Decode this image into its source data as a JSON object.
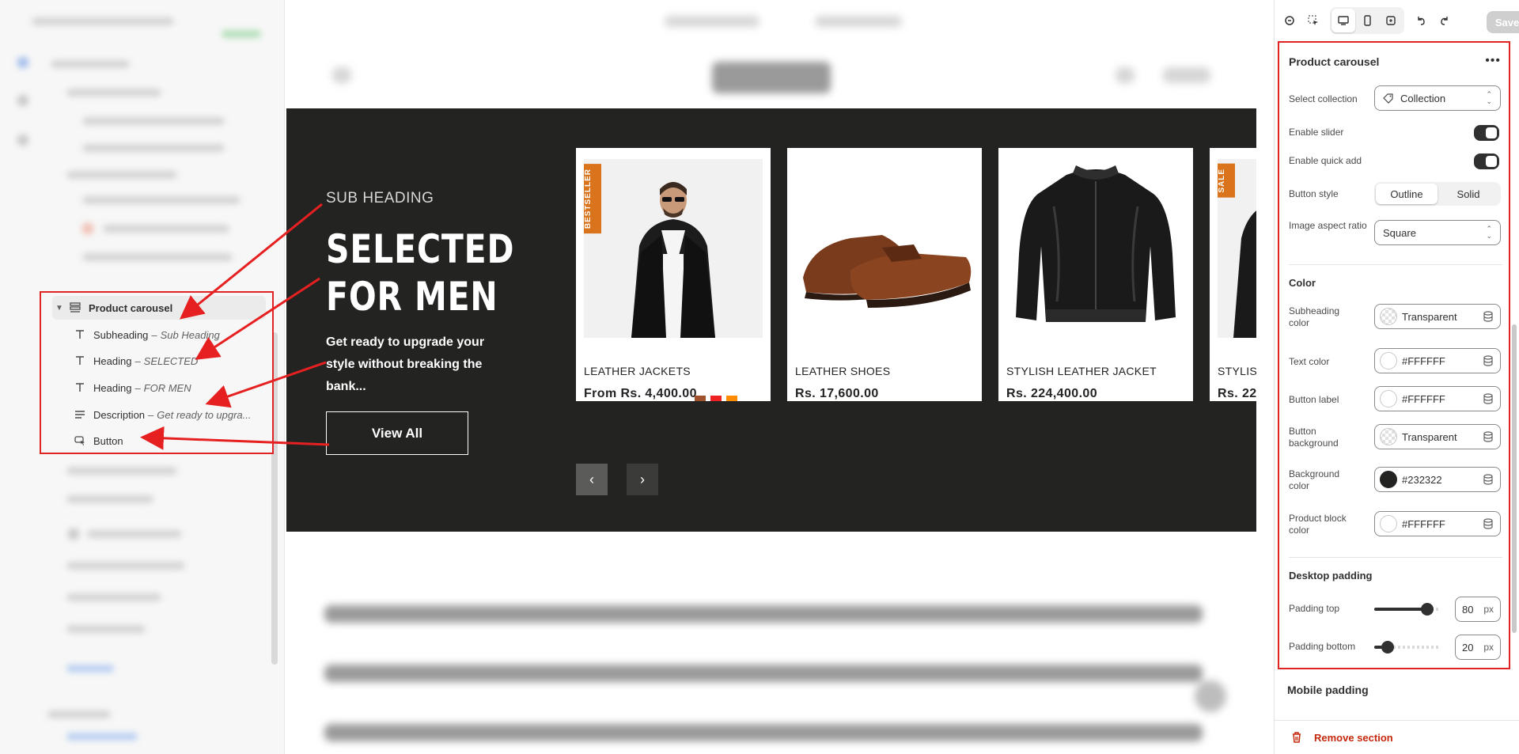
{
  "tree": {
    "parent": "Product carousel",
    "items": [
      {
        "label": "Subheading",
        "sub": "Sub Heading",
        "icon": "text-icon"
      },
      {
        "label": "Heading",
        "sub": "SELECTED",
        "icon": "text-icon"
      },
      {
        "label": "Heading",
        "sub": "FOR MEN",
        "icon": "text-icon"
      },
      {
        "label": "Description",
        "sub": "Get ready to upgra...",
        "icon": "paragraph-icon"
      },
      {
        "label": "Button",
        "sub": "",
        "icon": "button-cursor-icon"
      }
    ],
    "separator": "–"
  },
  "hero": {
    "subheading": "SUB HEADING",
    "heading_line1": "SELECTED",
    "heading_line2": "FOR MEN",
    "description": "Get ready to upgrade your style without breaking the bank...",
    "button": "View All",
    "background": "#232322"
  },
  "products": [
    {
      "title": "LEATHER JACKETS",
      "price": "From Rs. 4,400.00",
      "badge": "BESTSELLER",
      "swatches": [
        "#000000",
        "#a0522d",
        "#ee2222",
        "#ff8c00"
      ]
    },
    {
      "title": "LEATHER SHOES",
      "price": "Rs. 17,600.00",
      "badge": "",
      "swatches": [
        "#a0522d",
        "#000000"
      ]
    },
    {
      "title": "STYLISH LEATHER JACKET",
      "price": "Rs. 224,400.00",
      "badge": "",
      "swatches": [
        "#000000"
      ]
    },
    {
      "title": "STYLISH",
      "price": "Rs. 22",
      "badge": "SALE",
      "swatches": []
    }
  ],
  "carousel_nav": {
    "prev": "‹",
    "next": "›"
  },
  "panel": {
    "save": "Save",
    "title": "Product carousel",
    "more": "•••",
    "select_collection_label": "Select collection",
    "select_collection_value": "Collection",
    "enable_slider_label": "Enable slider",
    "enable_slider": true,
    "enable_quick_add_label": "Enable quick add",
    "enable_quick_add": true,
    "button_style_label": "Button style",
    "button_style_options": [
      "Outline",
      "Solid"
    ],
    "button_style_selected": "Outline",
    "image_aspect_label": "Image aspect ratio",
    "image_aspect_value": "Square",
    "color_heading": "Color",
    "colors": [
      {
        "label": "Subheading color",
        "value": "Transparent",
        "swatch": "transparent"
      },
      {
        "label": "Text color",
        "value": "#FFFFFF",
        "swatch": "#FFFFFF"
      },
      {
        "label": "Button label",
        "value": "#FFFFFF",
        "swatch": "#FFFFFF"
      },
      {
        "label": "Button background",
        "value": "Transparent",
        "swatch": "transparent"
      },
      {
        "label": "Background color",
        "value": "#232322",
        "swatch": "#232322"
      },
      {
        "label": "Product block color",
        "value": "#FFFFFF",
        "swatch": "#FFFFFF"
      }
    ],
    "desktop_padding_heading": "Desktop padding",
    "padding_top_label": "Padding top",
    "padding_top_value": "80",
    "padding_top_fraction": 0.8,
    "padding_bottom_label": "Padding bottom",
    "padding_bottom_value": "20",
    "padding_bottom_fraction": 0.2,
    "unit": "px",
    "mobile_padding_heading": "Mobile padding",
    "remove_section": "Remove section"
  },
  "accent": {
    "highlight": "#e02424",
    "badge": "#d9731c",
    "danger": "#c5280c"
  }
}
